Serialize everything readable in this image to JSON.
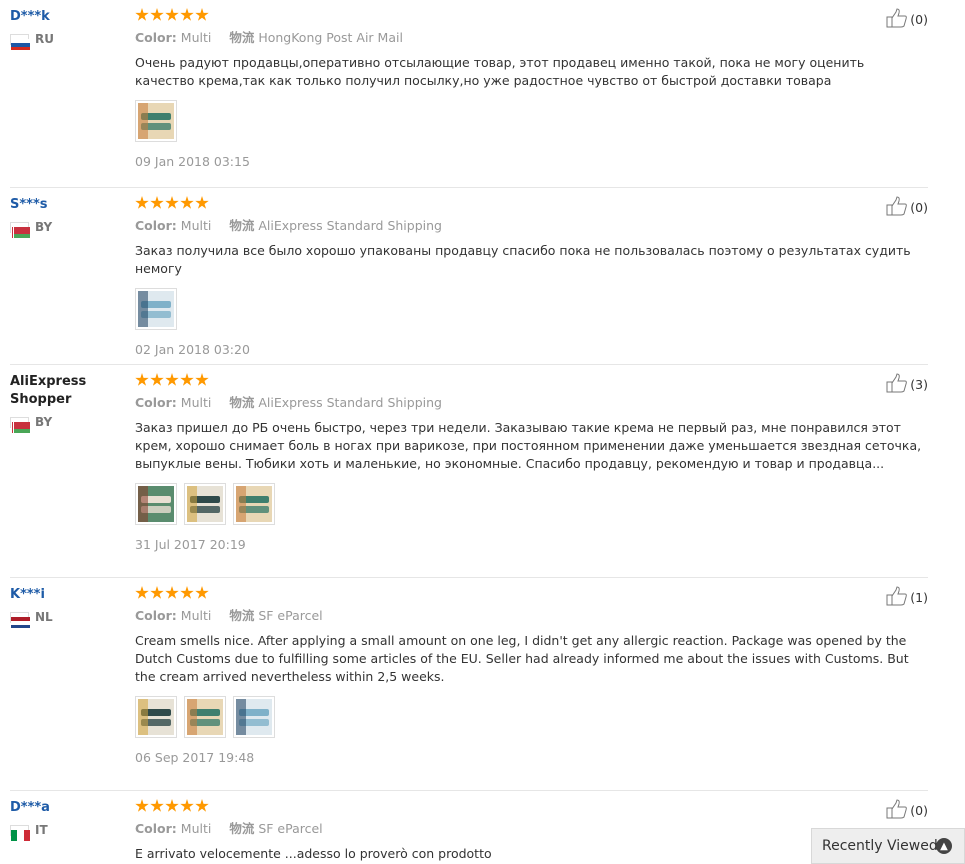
{
  "reviews": [
    {
      "user": "D***k",
      "user_style": "link",
      "country": "RU",
      "flag": "ru",
      "rating": 5,
      "color_label": "Color:",
      "color_value": "Multi",
      "ship_label": "物流",
      "ship_value": "HongKong Post Air Mail",
      "text": "Очень радуют продавцы,оперативно отсылающие товар, этот продавец именно такой, пока не могу оценить качество крема,так как только получил посылку,но уже радостное чувство от быстрой доставки товара",
      "photos": 1,
      "date": "09 Jan 2018 03:15",
      "likes": "(0)"
    },
    {
      "user": "S***s",
      "user_style": "link",
      "country": "BY",
      "flag": "by",
      "rating": 5,
      "color_label": "Color:",
      "color_value": "Multi",
      "ship_label": "物流",
      "ship_value": "AliExpress Standard Shipping",
      "text": "Заказ получила все было хорошо упакованы продавцу спасибо пока не пользовалась поэтому о результатах судить немогу",
      "photos": 1,
      "date": "02 Jan 2018 03:20",
      "likes": "(0)"
    },
    {
      "user": "AliExpress Shopper",
      "user_style": "plain",
      "country": "BY",
      "flag": "by",
      "rating": 5,
      "color_label": "Color:",
      "color_value": "Multi",
      "ship_label": "物流",
      "ship_value": "AliExpress Standard Shipping",
      "text": "Заказ пришел до РБ очень быстро, через три недели. Заказываю такие крема не первый раз, мне понравился этот крем, хорошо снимает боль в ногах при варикозе, при постоянном применении даже уменьшается звездная сеточка, выпуклые вены. Тюбики хоть и маленькие, но экономные. Спасибо продавцу, рекомендую и товар и продавца...",
      "photos": 3,
      "date": "31 Jul 2017 20:19",
      "likes": "(3)"
    },
    {
      "user": "K***i",
      "user_style": "link",
      "country": "NL",
      "flag": "nl",
      "rating": 5,
      "color_label": "Color:",
      "color_value": "Multi",
      "ship_label": "物流",
      "ship_value": "SF eParcel",
      "text": "Cream smells nice. After applying a small amount on one leg, I didn't get any allergic reaction. Package was opened by the Dutch Customs due to fulfilling some articles of the EU. Seller had already informed me about the issues with Customs. But the cream arrived nevertheless within 2,5 weeks.",
      "photos": 3,
      "date": "06 Sep 2017 19:48",
      "likes": "(1)"
    },
    {
      "user": "D***a",
      "user_style": "link",
      "country": "IT",
      "flag": "it",
      "rating": 5,
      "color_label": "Color:",
      "color_value": "Multi",
      "ship_label": "物流",
      "ship_value": "SF eParcel",
      "text": "E arrivato velocemente ...adesso lo proverò con prodotto",
      "photos": 0,
      "date": "",
      "likes": "(0)"
    }
  ],
  "recently_viewed": {
    "label": "Recently Viewed",
    "icon": "chevron-up-icon"
  },
  "colors": {
    "star": "#ff9900",
    "link": "#1e5ba7",
    "muted": "#999999"
  }
}
